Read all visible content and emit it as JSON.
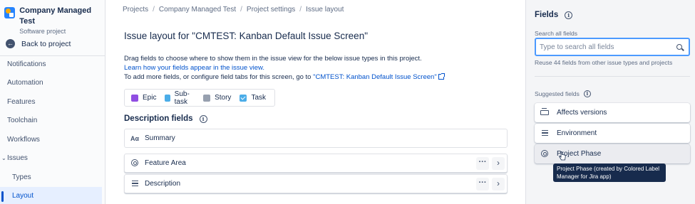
{
  "sidebar": {
    "project_name": "Company Managed Test",
    "project_type": "Software project",
    "back_label": "Back to project",
    "items": [
      {
        "label": "Notifications"
      },
      {
        "label": "Automation"
      },
      {
        "label": "Features"
      },
      {
        "label": "Toolchain"
      },
      {
        "label": "Workflows"
      },
      {
        "label": "Issues"
      },
      {
        "label": "Types"
      },
      {
        "label": "Layout"
      }
    ]
  },
  "breadcrumb": [
    "Projects",
    "Company Managed Test",
    "Project settings",
    "Issue layout"
  ],
  "main": {
    "title": "Issue layout for \"CMTEST: Kanban Default Issue Screen\"",
    "desc_line1": "Drag fields to choose where to show them in the issue view for the below issue types in this project.",
    "desc_link": "Learn how your fields appear in the issue view.",
    "desc_line3_prefix": "To add more fields, or configure field tabs for this screen, go to ",
    "desc_line3_link": "\"CMTEST: Kanban Default Issue Screen\"",
    "issue_types": [
      {
        "label": "Epic",
        "icon": "epic-icon",
        "color": "#904ee2"
      },
      {
        "label": "Sub-task",
        "icon": "subtask-icon",
        "color": "#4bade8"
      },
      {
        "label": "Story",
        "icon": "story-icon",
        "color": "#97a0af"
      },
      {
        "label": "Task",
        "icon": "task-icon",
        "color": "#4bade8"
      }
    ],
    "section_title": "Description fields",
    "fields": [
      {
        "label": "Summary",
        "icon": "summary-icon"
      },
      {
        "label": "Feature Area",
        "icon": "select-field-icon"
      },
      {
        "label": "Description",
        "icon": "paragraph-icon"
      }
    ]
  },
  "right_panel": {
    "title": "Fields",
    "search_label": "Search all fields",
    "search_placeholder": "Type to search all fields",
    "reuse_text": "Reuse 44 fields from other issue types and projects",
    "suggested_title": "Suggested fields",
    "suggested": [
      {
        "label": "Affects versions",
        "icon": "versions-icon"
      },
      {
        "label": "Environment",
        "icon": "paragraph-icon"
      },
      {
        "label": "Project Phase",
        "icon": "select-field-icon"
      }
    ],
    "tooltip": "Project Phase (created by Colored Label Manager for Jira app)"
  },
  "colors": {
    "accent": "#0052cc",
    "focus": "#4c9aff",
    "active_bg": "#e6efff"
  }
}
